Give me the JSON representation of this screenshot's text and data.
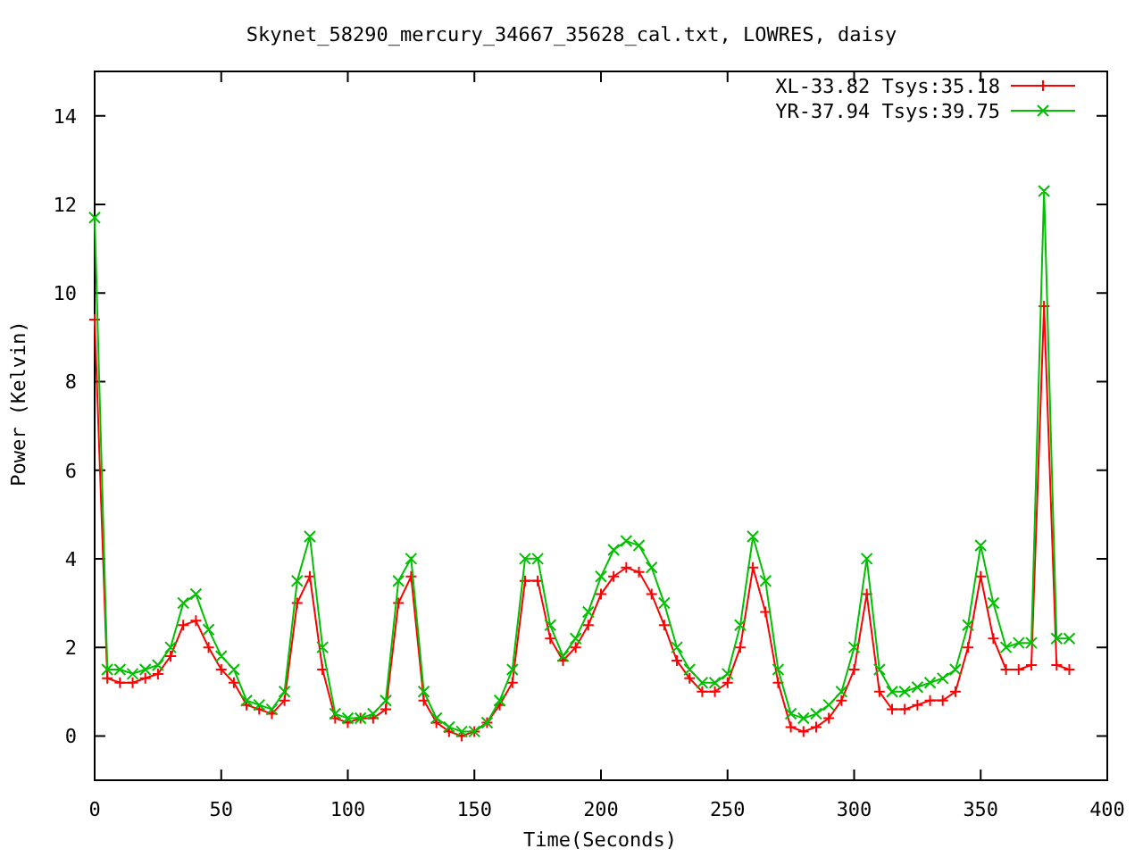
{
  "chart_data": {
    "type": "line",
    "title": "Skynet_58290_mercury_34667_35628_cal.txt, LOWRES, daisy",
    "xlabel": "Time(Seconds)",
    "ylabel": "Power (Kelvin)",
    "xlim": [
      0,
      400
    ],
    "ylim": [
      -1,
      15
    ],
    "legend": true,
    "xticks": [
      0,
      50,
      100,
      150,
      200,
      250,
      300,
      350,
      400
    ],
    "yticks": [
      0,
      2,
      4,
      6,
      8,
      10,
      12,
      14
    ],
    "x": [
      0,
      5,
      10,
      15,
      20,
      25,
      30,
      35,
      40,
      45,
      50,
      55,
      60,
      65,
      70,
      75,
      80,
      85,
      90,
      95,
      100,
      105,
      110,
      115,
      120,
      125,
      130,
      135,
      140,
      145,
      150,
      155,
      160,
      165,
      170,
      175,
      180,
      185,
      190,
      195,
      200,
      205,
      210,
      215,
      220,
      225,
      230,
      235,
      240,
      245,
      250,
      255,
      260,
      265,
      270,
      275,
      280,
      285,
      290,
      295,
      300,
      305,
      310,
      315,
      320,
      325,
      330,
      335,
      340,
      345,
      350,
      355,
      360,
      365,
      370,
      375,
      380,
      385
    ],
    "series": [
      {
        "name": "XL-33.82 Tsys:35.18",
        "color": "#ff0000",
        "marker": "plus",
        "values": [
          9.4,
          1.3,
          1.2,
          1.2,
          1.3,
          1.4,
          1.8,
          2.5,
          2.6,
          2.0,
          1.5,
          1.2,
          0.7,
          0.6,
          0.5,
          0.8,
          3.0,
          3.6,
          1.5,
          0.4,
          0.3,
          0.4,
          0.4,
          0.6,
          3.0,
          3.6,
          0.8,
          0.3,
          0.1,
          0.0,
          0.1,
          0.3,
          0.7,
          1.2,
          3.5,
          3.5,
          2.2,
          1.7,
          2.0,
          2.5,
          3.2,
          3.6,
          3.8,
          3.7,
          3.2,
          2.5,
          1.7,
          1.3,
          1.0,
          1.0,
          1.2,
          2.0,
          3.8,
          2.8,
          1.2,
          0.2,
          0.1,
          0.2,
          0.4,
          0.8,
          1.5,
          3.2,
          1.0,
          0.6,
          0.6,
          0.7,
          0.8,
          0.8,
          1.0,
          2.0,
          3.6,
          2.2,
          1.5,
          1.5,
          1.6,
          9.7,
          1.6,
          1.5
        ]
      },
      {
        "name": "YR-37.94 Tsys:39.75",
        "color": "#00c000",
        "marker": "cross",
        "values": [
          11.7,
          1.5,
          1.5,
          1.4,
          1.5,
          1.6,
          2.0,
          3.0,
          3.2,
          2.4,
          1.8,
          1.5,
          0.8,
          0.7,
          0.6,
          1.0,
          3.5,
          4.5,
          2.0,
          0.5,
          0.4,
          0.4,
          0.5,
          0.8,
          3.5,
          4.0,
          1.0,
          0.4,
          0.2,
          0.1,
          0.1,
          0.3,
          0.8,
          1.5,
          4.0,
          4.0,
          2.5,
          1.8,
          2.2,
          2.8,
          3.6,
          4.2,
          4.4,
          4.3,
          3.8,
          3.0,
          2.0,
          1.5,
          1.2,
          1.2,
          1.4,
          2.5,
          4.5,
          3.5,
          1.5,
          0.5,
          0.4,
          0.5,
          0.7,
          1.0,
          2.0,
          4.0,
          1.5,
          1.0,
          1.0,
          1.1,
          1.2,
          1.3,
          1.5,
          2.5,
          4.3,
          3.0,
          2.0,
          2.1,
          2.1,
          12.3,
          2.2,
          2.2
        ]
      }
    ]
  }
}
